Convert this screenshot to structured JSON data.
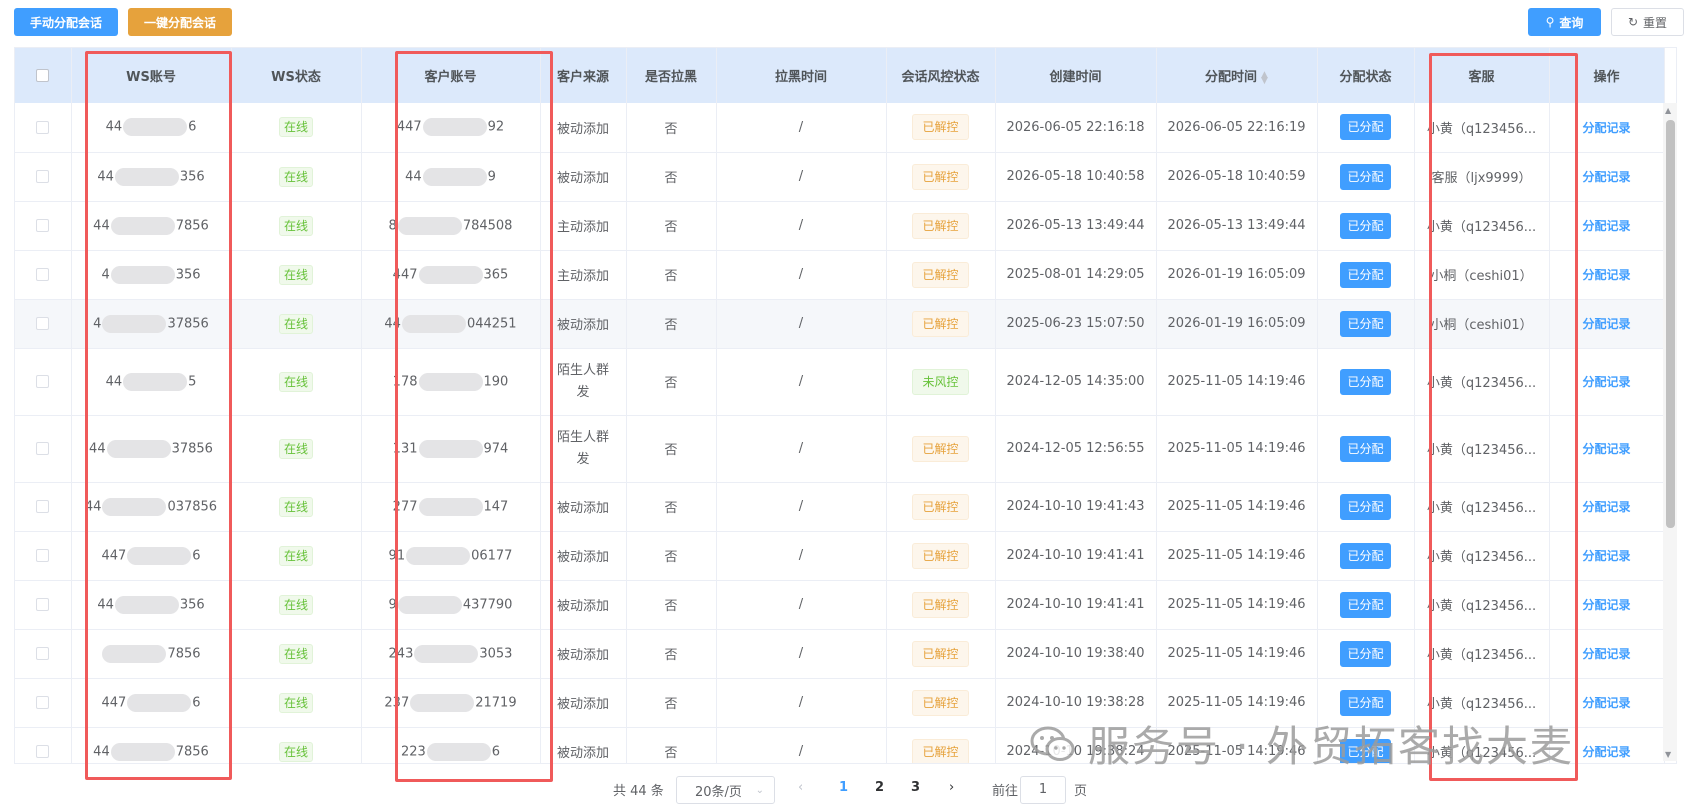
{
  "toolbar": {
    "manual_assign": "手动分配会话",
    "auto_assign": "一键分配会话",
    "search": "查询",
    "reset": "重置"
  },
  "table": {
    "headers": [
      "WS账号",
      "WS状态",
      "客户账号",
      "客户来源",
      "是否拉黑",
      "拉黑时间",
      "会话风控状态",
      "创建时间",
      "分配时间",
      "分配状态",
      "客服",
      "操作"
    ],
    "rows": [
      {
        "ws_pre": "44",
        "ws_suf": "6",
        "status": "在线",
        "cust_pre": "447",
        "cust_suf": "92",
        "source": "被动添加",
        "blocked": "否",
        "block_time": "/",
        "risk": "已解控",
        "created": "2026-06-05 22:16:18",
        "assigned": "2026-06-05 22:16:19",
        "assign_state": "已分配",
        "agent": "小黄（q123456...",
        "action": "分配记录"
      },
      {
        "ws_pre": "44",
        "ws_suf": "356",
        "status": "在线",
        "cust_pre": "44",
        "cust_suf": "9",
        "source": "被动添加",
        "blocked": "否",
        "block_time": "/",
        "risk": "已解控",
        "created": "2026-05-18 10:40:58",
        "assigned": "2026-05-18 10:40:59",
        "assign_state": "已分配",
        "agent": "客服（ljx9999）",
        "action": "分配记录"
      },
      {
        "ws_pre": "44",
        "ws_suf": "7856",
        "status": "在线",
        "cust_pre": "8",
        "cust_suf": "784508",
        "source": "主动添加",
        "blocked": "否",
        "block_time": "/",
        "risk": "已解控",
        "created": "2026-05-13 13:49:44",
        "assigned": "2026-05-13 13:49:44",
        "assign_state": "已分配",
        "agent": "小黄（q123456...",
        "action": "分配记录"
      },
      {
        "ws_pre": "4",
        "ws_suf": "356",
        "status": "在线",
        "cust_pre": "447",
        "cust_suf": "365",
        "source": "主动添加",
        "blocked": "否",
        "block_time": "/",
        "risk": "已解控",
        "created": "2025-08-01 14:29:05",
        "assigned": "2026-01-19 16:05:09",
        "assign_state": "已分配",
        "agent": "小桐（ceshi01）",
        "action": "分配记录"
      },
      {
        "ws_pre": "4",
        "ws_suf": "37856",
        "status": "在线",
        "cust_pre": "44",
        "cust_suf": "044251",
        "source": "被动添加",
        "blocked": "否",
        "block_time": "/",
        "risk": "已解控",
        "created": "2025-06-23 15:07:50",
        "assigned": "2026-01-19 16:05:09",
        "assign_state": "已分配",
        "agent": "小桐（ceshi01）",
        "action": "分配记录"
      },
      {
        "ws_pre": "44",
        "ws_suf": "5",
        "status": "在线",
        "cust_pre": "178",
        "cust_suf": "190",
        "source": "陌生人群发",
        "blocked": "否",
        "block_time": "/",
        "risk": "未风控",
        "created": "2024-12-05 14:35:00",
        "assigned": "2025-11-05 14:19:46",
        "assign_state": "已分配",
        "agent": "小黄（q123456...",
        "action": "分配记录"
      },
      {
        "ws_pre": "44",
        "ws_suf": "37856",
        "status": "在线",
        "cust_pre": "131",
        "cust_suf": "974",
        "source": "陌生人群发",
        "blocked": "否",
        "block_time": "/",
        "risk": "已解控",
        "created": "2024-12-05 12:56:55",
        "assigned": "2025-11-05 14:19:46",
        "assign_state": "已分配",
        "agent": "小黄（q123456...",
        "action": "分配记录"
      },
      {
        "ws_pre": "44",
        "ws_suf": "037856",
        "status": "在线",
        "cust_pre": "277",
        "cust_suf": "147",
        "source": "被动添加",
        "blocked": "否",
        "block_time": "/",
        "risk": "已解控",
        "created": "2024-10-10 19:41:43",
        "assigned": "2025-11-05 14:19:46",
        "assign_state": "已分配",
        "agent": "小黄（q123456...",
        "action": "分配记录"
      },
      {
        "ws_pre": "447",
        "ws_suf": "6",
        "status": "在线",
        "cust_pre": "91",
        "cust_suf": "06177",
        "source": "被动添加",
        "blocked": "否",
        "block_time": "/",
        "risk": "已解控",
        "created": "2024-10-10 19:41:41",
        "assigned": "2025-11-05 14:19:46",
        "assign_state": "已分配",
        "agent": "小黄（q123456...",
        "action": "分配记录"
      },
      {
        "ws_pre": "44",
        "ws_suf": "356",
        "status": "在线",
        "cust_pre": "9",
        "cust_suf": "437790",
        "source": "被动添加",
        "blocked": "否",
        "block_time": "/",
        "risk": "已解控",
        "created": "2024-10-10 19:41:41",
        "assigned": "2025-11-05 14:19:46",
        "assign_state": "已分配",
        "agent": "小黄（q123456...",
        "action": "分配记录"
      },
      {
        "ws_pre": "",
        "ws_suf": "7856",
        "status": "在线",
        "cust_pre": "243",
        "cust_suf": "3053",
        "source": "被动添加",
        "blocked": "否",
        "block_time": "/",
        "risk": "已解控",
        "created": "2024-10-10 19:38:40",
        "assigned": "2025-11-05 14:19:46",
        "assign_state": "已分配",
        "agent": "小黄（q123456...",
        "action": "分配记录"
      },
      {
        "ws_pre": "447",
        "ws_suf": "6",
        "status": "在线",
        "cust_pre": "237",
        "cust_suf": "21719",
        "source": "被动添加",
        "blocked": "否",
        "block_time": "/",
        "risk": "已解控",
        "created": "2024-10-10 19:38:28",
        "assigned": "2025-11-05 14:19:46",
        "assign_state": "已分配",
        "agent": "小黄（q123456...",
        "action": "分配记录"
      },
      {
        "ws_pre": "44",
        "ws_suf": "7856",
        "status": "在线",
        "cust_pre": "223",
        "cust_suf": "6",
        "source": "被动添加",
        "blocked": "否",
        "block_time": "/",
        "risk": "已解控",
        "created": "2024-10-10 19:38:24",
        "assigned": "2025-11-05 14:19:46",
        "assign_state": "已分配",
        "agent": "小黄（q123456...",
        "action": "分配记录"
      }
    ]
  },
  "pagination": {
    "total": "共 44 条",
    "page_size": "20条/页",
    "pages": [
      "1",
      "2",
      "3"
    ],
    "current": "1",
    "goto_prefix": "前往",
    "goto_value": "1",
    "goto_suffix": "页"
  },
  "watermark": "服务号 · 外贸拓客找大麦"
}
